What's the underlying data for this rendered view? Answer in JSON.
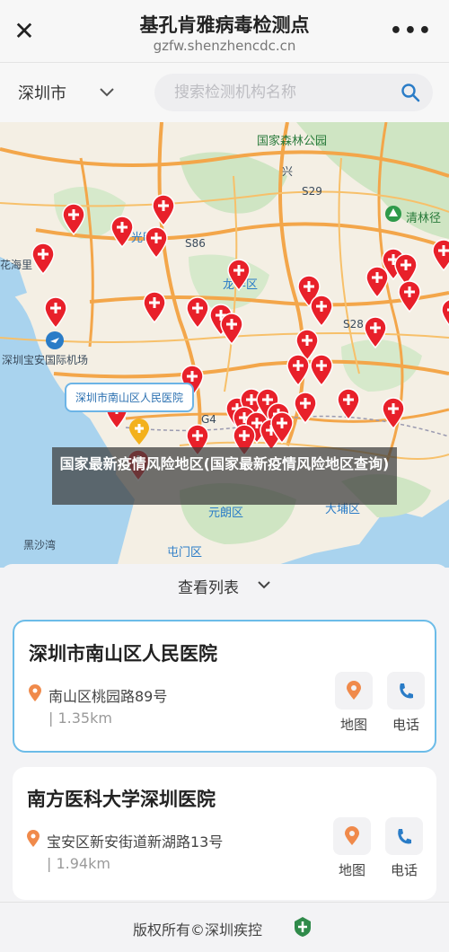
{
  "header": {
    "title": "基孔肯雅病毒检测点",
    "url": "gzfw.shenzhencdc.cn"
  },
  "search": {
    "city": "深圳市",
    "placeholder": "搜索检测机构名称"
  },
  "map": {
    "labels": {
      "park": "国家森林公园",
      "guangming": "光明",
      "longhua": "龙华区",
      "huaxiaoli": "花海里",
      "airport": "深圳宝安国际机场",
      "s86": "S86",
      "s29": "S29",
      "s28": "S28",
      "g4": "G4",
      "qinglinjing": "清林径",
      "yuanlang": "元朗区",
      "tunmen": "屯门区",
      "dapu": "大埔区",
      "heishazhou": "黑沙湾",
      "xiong": "兴"
    },
    "callout": "深圳市南山区人民医院",
    "banner": "国家最新疫情风险地区(国家最新疫情风险地区查询)"
  },
  "list_toggle": "查看列表",
  "cards": [
    {
      "name": "深圳市南山区人民医院",
      "address": "南山区桃园路89号",
      "distance": "| 1.35km",
      "map_label": "地图",
      "phone_label": "电话"
    },
    {
      "name": "南方医科大学深圳医院",
      "address": "宝安区新安街道新湖路13号",
      "distance": "| 1.94km",
      "map_label": "地图",
      "phone_label": "电话"
    }
  ],
  "footer": "版权所有©深圳疾控",
  "colors": {
    "pin": "#e8202a",
    "accent": "#2a7cc7",
    "selected_border": "#6cbce8",
    "location_icon": "#f08a4b"
  }
}
